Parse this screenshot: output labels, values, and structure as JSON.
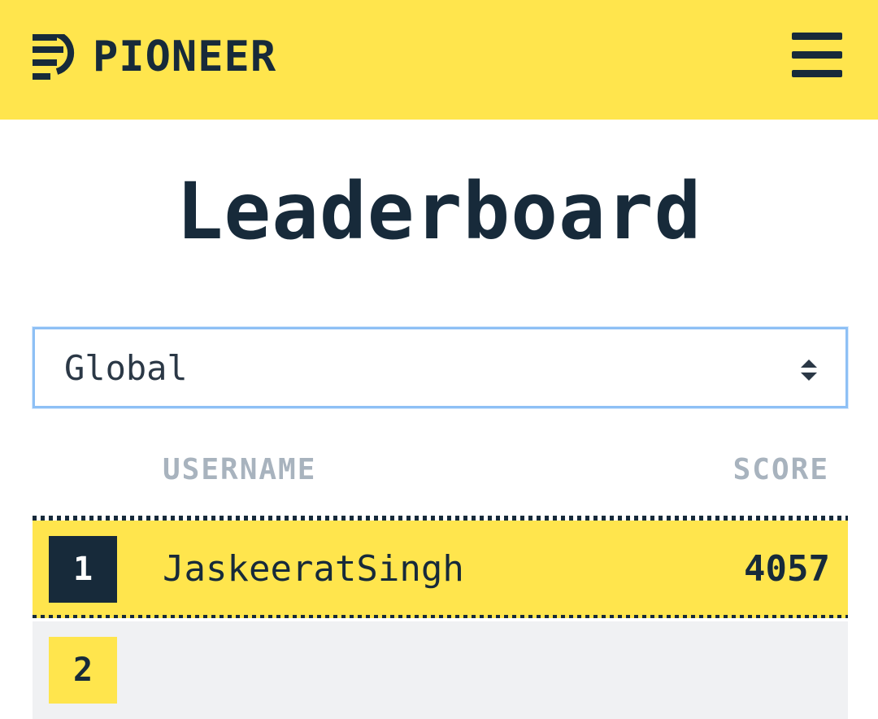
{
  "header": {
    "brand": "PIONEER",
    "logo_icon": "pioneer-logo-icon",
    "menu_icon": "hamburger-menu-icon",
    "background_color": "#ffe54d",
    "text_color": "#172a3a"
  },
  "page": {
    "title": "Leaderboard"
  },
  "filter": {
    "selected": "Global",
    "icon": "select-arrows-icon"
  },
  "table": {
    "columns": {
      "username": "USERNAME",
      "score": "SCORE"
    },
    "rows": [
      {
        "rank": "1",
        "username": "JaskeeratSingh",
        "score": "4057"
      },
      {
        "rank": "2",
        "username": "",
        "score": ""
      }
    ]
  },
  "colors": {
    "accent": "#ffe54d",
    "dark": "#172a3a",
    "muted": "#a8b3be",
    "focus_border": "#8ec0f5",
    "alt_row": "#f0f1f3"
  }
}
